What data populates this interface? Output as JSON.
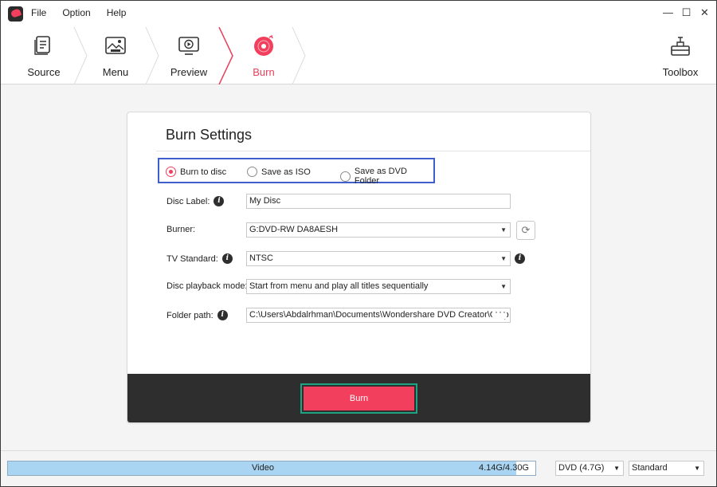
{
  "menu": {
    "items": [
      "File",
      "Option",
      "Help"
    ]
  },
  "window_controls": {
    "minimize": "—",
    "maximize": "☐",
    "close": "✕"
  },
  "steps": [
    {
      "label": "Source",
      "icon": "document-icon"
    },
    {
      "label": "Menu",
      "icon": "image-icon"
    },
    {
      "label": "Preview",
      "icon": "monitor-play-icon"
    },
    {
      "label": "Burn",
      "icon": "disc-icon",
      "active": true
    }
  ],
  "toolbox": {
    "label": "Toolbox",
    "icon": "toolbox-icon"
  },
  "burn_settings": {
    "title": "Burn Settings",
    "output_options": [
      {
        "label": "Burn to disc",
        "checked": true
      },
      {
        "label": "Save as ISO",
        "checked": false
      },
      {
        "label": "Save as DVD Folder",
        "checked": false
      }
    ],
    "disc_label": {
      "label": "Disc Label:",
      "value": "My Disc"
    },
    "burner": {
      "label": "Burner:",
      "value": "G:DVD-RW DA8AESH"
    },
    "tv_standard": {
      "label": "TV Standard:",
      "value": "NTSC"
    },
    "playback_mode": {
      "label": "Disc playback mode:",
      "value": "Start from menu and play all titles sequentially"
    },
    "folder_path": {
      "label": "Folder path:",
      "value": "C:\\Users\\Abdalrhman\\Documents\\Wondershare DVD Creator\\Outp",
      "browse": "···"
    },
    "burn_button": "Burn"
  },
  "status": {
    "capacity_label": "Video",
    "capacity_size": "4.14G/4.30G",
    "capacity_fraction": 0.963,
    "disc_type": "DVD (4.7G)",
    "quality": "Standard"
  },
  "colors": {
    "accent": "#f23f5d",
    "highlight_blue": "#3f5fcf",
    "highlight_green": "#1fa383",
    "progress": "#a9d4f2"
  }
}
